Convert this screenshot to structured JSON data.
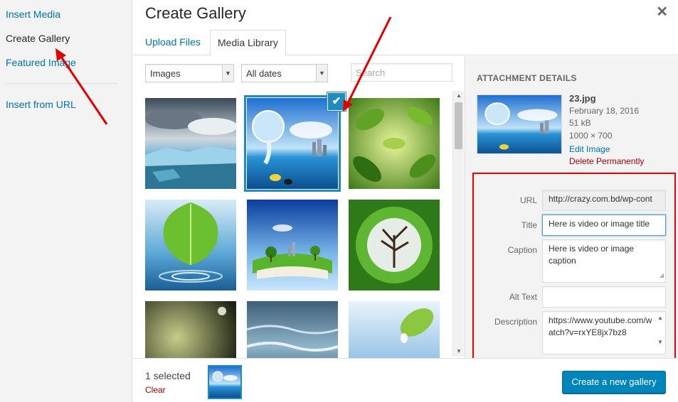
{
  "menu": {
    "items": [
      {
        "label": "Insert Media"
      },
      {
        "label": "Create Gallery"
      },
      {
        "label": "Featured Image"
      },
      {
        "label": "Insert from URL"
      }
    ]
  },
  "frame": {
    "title": "Create Gallery",
    "close_icon": "close-icon",
    "tabs": [
      {
        "label": "Upload Files"
      },
      {
        "label": "Media Library"
      }
    ]
  },
  "toolbar": {
    "type_filter": "Images",
    "date_filter": "All dates",
    "search_placeholder": "Search"
  },
  "grid": {
    "selected_index": 1,
    "items": [
      {
        "name": "glacier-photo"
      },
      {
        "name": "water-pitcher-photo"
      },
      {
        "name": "green-leaves-photo"
      },
      {
        "name": "leaf-water-drop-photo"
      },
      {
        "name": "book-landscape-photo"
      },
      {
        "name": "tree-sphere-photo"
      },
      {
        "name": "dark-landscape-photo"
      },
      {
        "name": "ocean-waves-photo"
      },
      {
        "name": "leaf-drop-photo"
      }
    ]
  },
  "details": {
    "heading": "Attachment Details",
    "filename": "23.jpg",
    "date": "February 18, 2016",
    "size": "51 kB",
    "dimensions": "1000 × 700",
    "edit_label": "Edit Image",
    "delete_label": "Delete Permanently",
    "fields": {
      "url_label": "URL",
      "url_value": "http://crazy.com.bd/wp-cont",
      "title_label": "Title",
      "title_value": "Here is video or image title",
      "caption_label": "Caption",
      "caption_value": "Here is video or image caption",
      "alt_label": "Alt Text",
      "alt_value": "",
      "description_label": "Description",
      "description_value": "https://www.youtube.com/watch?v=rxYE8jx7bz8"
    }
  },
  "selection": {
    "count_label": "1 selected",
    "clear_label": "Clear"
  },
  "actions": {
    "create_label": "Create a new gallery"
  },
  "colors": {
    "accent": "#0073aa",
    "primary_button": "#0085ba",
    "selection_border": "#1e8cbe",
    "annotation": "#e00000",
    "danger": "#aa0000"
  }
}
